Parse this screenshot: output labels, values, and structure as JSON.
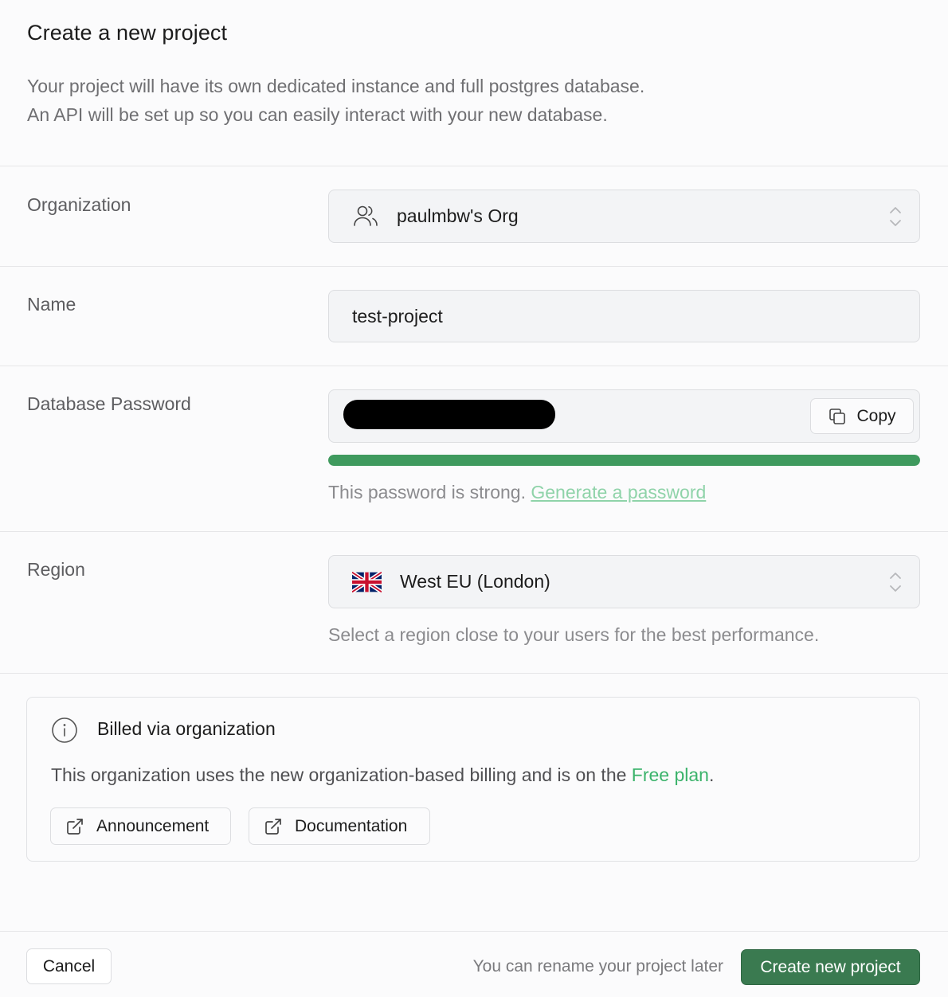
{
  "header": {
    "title": "Create a new project",
    "subtitle_line1": "Your project will have its own dedicated instance and full postgres database.",
    "subtitle_line2": "An API will be set up so you can easily interact with your new database."
  },
  "organization": {
    "label": "Organization",
    "value": "paulmbw's Org",
    "icon": "users-icon"
  },
  "name": {
    "label": "Name",
    "value": "test-project"
  },
  "password": {
    "label": "Database Password",
    "copy_label": "Copy",
    "strength_percent": 100,
    "strength_color": "#3f9a5e",
    "hint": "This password is strong.",
    "generate_link": "Generate a password"
  },
  "region": {
    "label": "Region",
    "value": "West EU (London)",
    "flag_icon": "uk-flag-icon",
    "hint": "Select a region close to your users for the best performance."
  },
  "billing": {
    "title": "Billed via organization",
    "text_before": "This organization uses the new organization-based billing and is on the ",
    "plan_link": "Free plan",
    "text_after": ".",
    "announcement_label": "Announcement",
    "documentation_label": "Documentation"
  },
  "footer": {
    "cancel_label": "Cancel",
    "rename_note": "You can rename your project later",
    "create_label": "Create new project",
    "accent_color": "#3a7a50"
  }
}
